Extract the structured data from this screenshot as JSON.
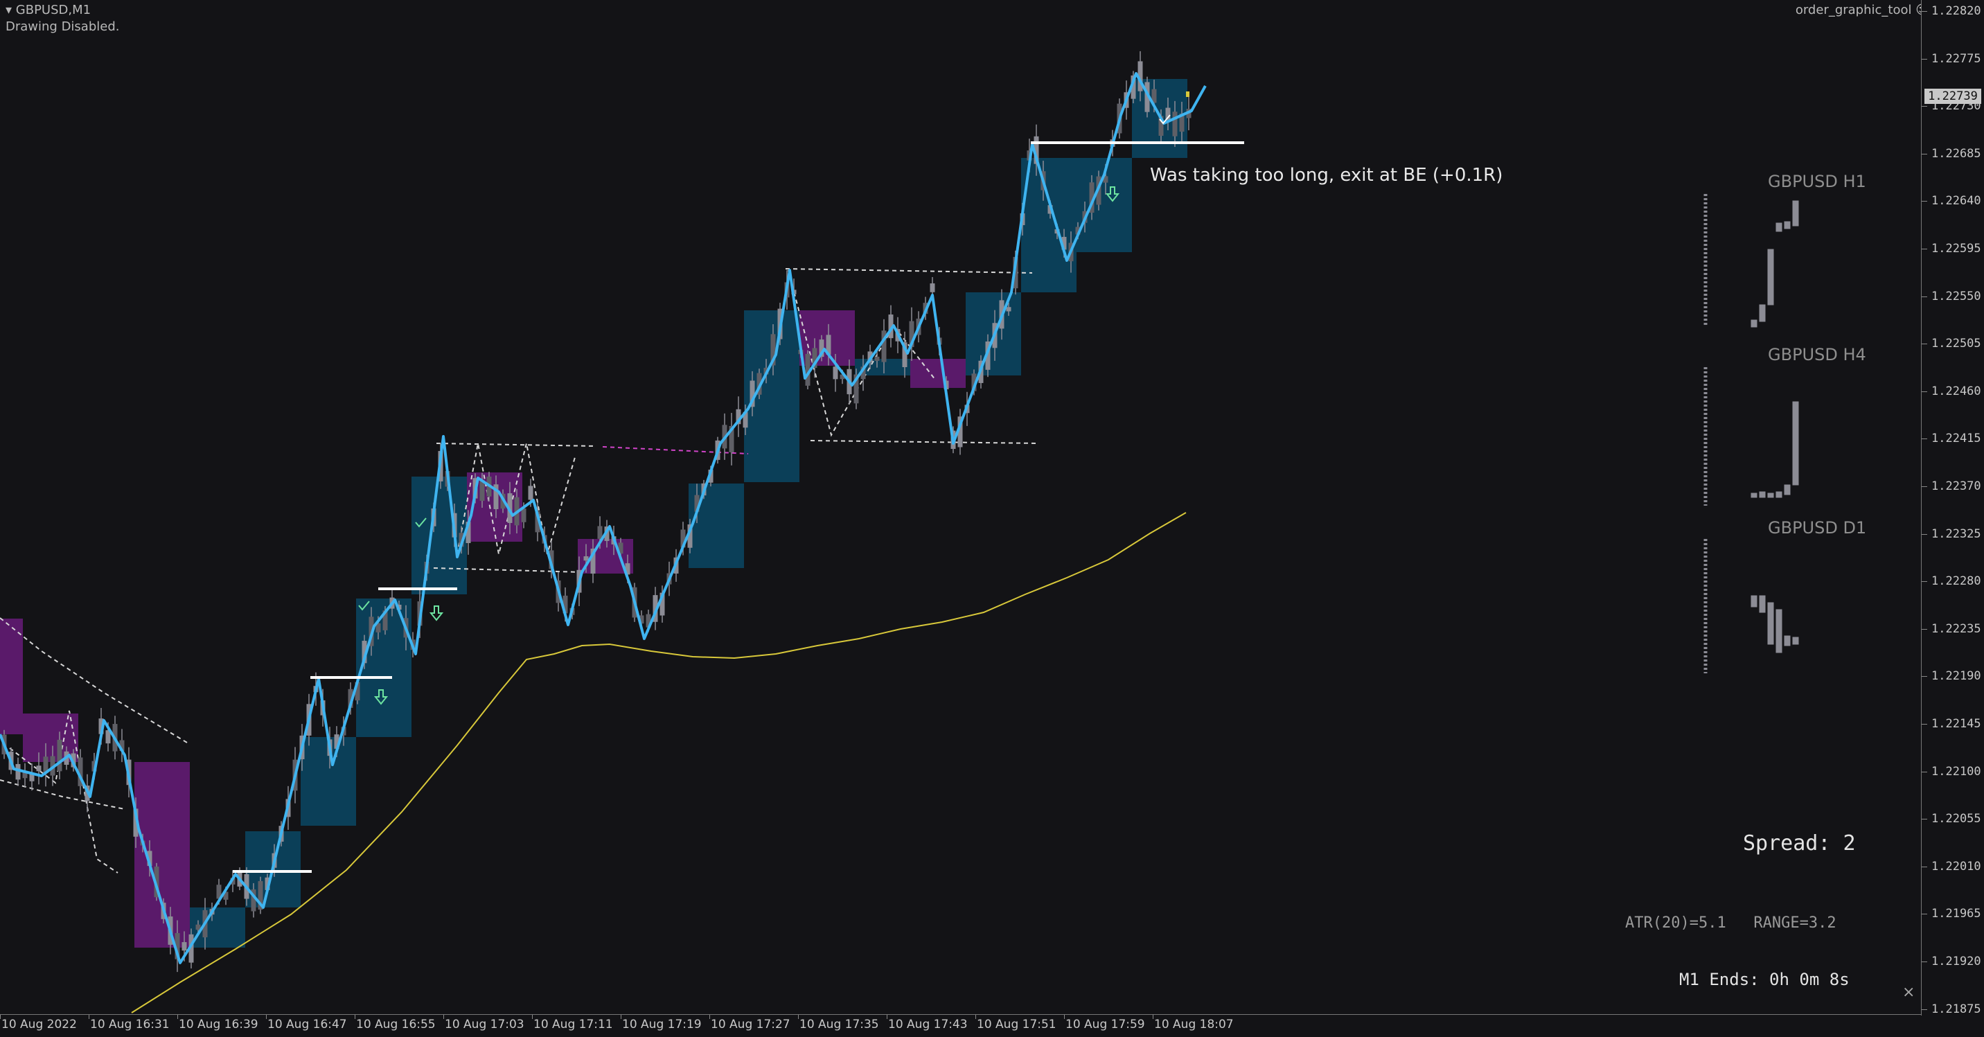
{
  "header": {
    "symbol": "GBPUSD,M1",
    "status": "Drawing Disabled.",
    "tool": "order_graphic_tool",
    "tool_icon": "smiley-icon",
    "dropdown_icon": "triangle-down-icon"
  },
  "price_axis": {
    "labels": [
      "1.22820",
      "1.22775",
      "1.22730",
      "1.22685",
      "1.22640",
      "1.22595",
      "1.22550",
      "1.22505",
      "1.22460",
      "1.22415",
      "1.22370",
      "1.22325",
      "1.22280",
      "1.22235",
      "1.22190",
      "1.22145",
      "1.22100",
      "1.22055",
      "1.22010",
      "1.21965",
      "1.21920",
      "1.21875"
    ],
    "current_price": "1.22739"
  },
  "time_axis": [
    "10 Aug 2022",
    "10 Aug 16:31",
    "10 Aug 16:39",
    "10 Aug 16:47",
    "10 Aug 16:55",
    "10 Aug 17:03",
    "10 Aug 17:11",
    "10 Aug 17:19",
    "10 Aug 17:27",
    "10 Aug 17:35",
    "10 Aug 17:43",
    "10 Aug 17:51",
    "10 Aug 17:59",
    "10 Aug 18:07"
  ],
  "annotation": "Was taking too long, exit at BE (+0.1R)",
  "mini_charts": [
    {
      "label": "GBPUSD H1"
    },
    {
      "label": "GBPUSD H4"
    },
    {
      "label": "GBPUSD D1"
    }
  ],
  "spread": "Spread: 2",
  "stats": "ATR(20)=5.1   RANGE=3.2",
  "bar_timer": "M1 Ends: 0h 0m 8s",
  "colors": {
    "background": "#131316",
    "bull_box": "#0b3f58",
    "bear_box": "#5a1a6a",
    "zigzag": "#3fb4f0",
    "ma": "#d8c83a",
    "candle": "#8c8c95",
    "arrow": "#6de3a0",
    "check": "#7be3a5"
  }
}
